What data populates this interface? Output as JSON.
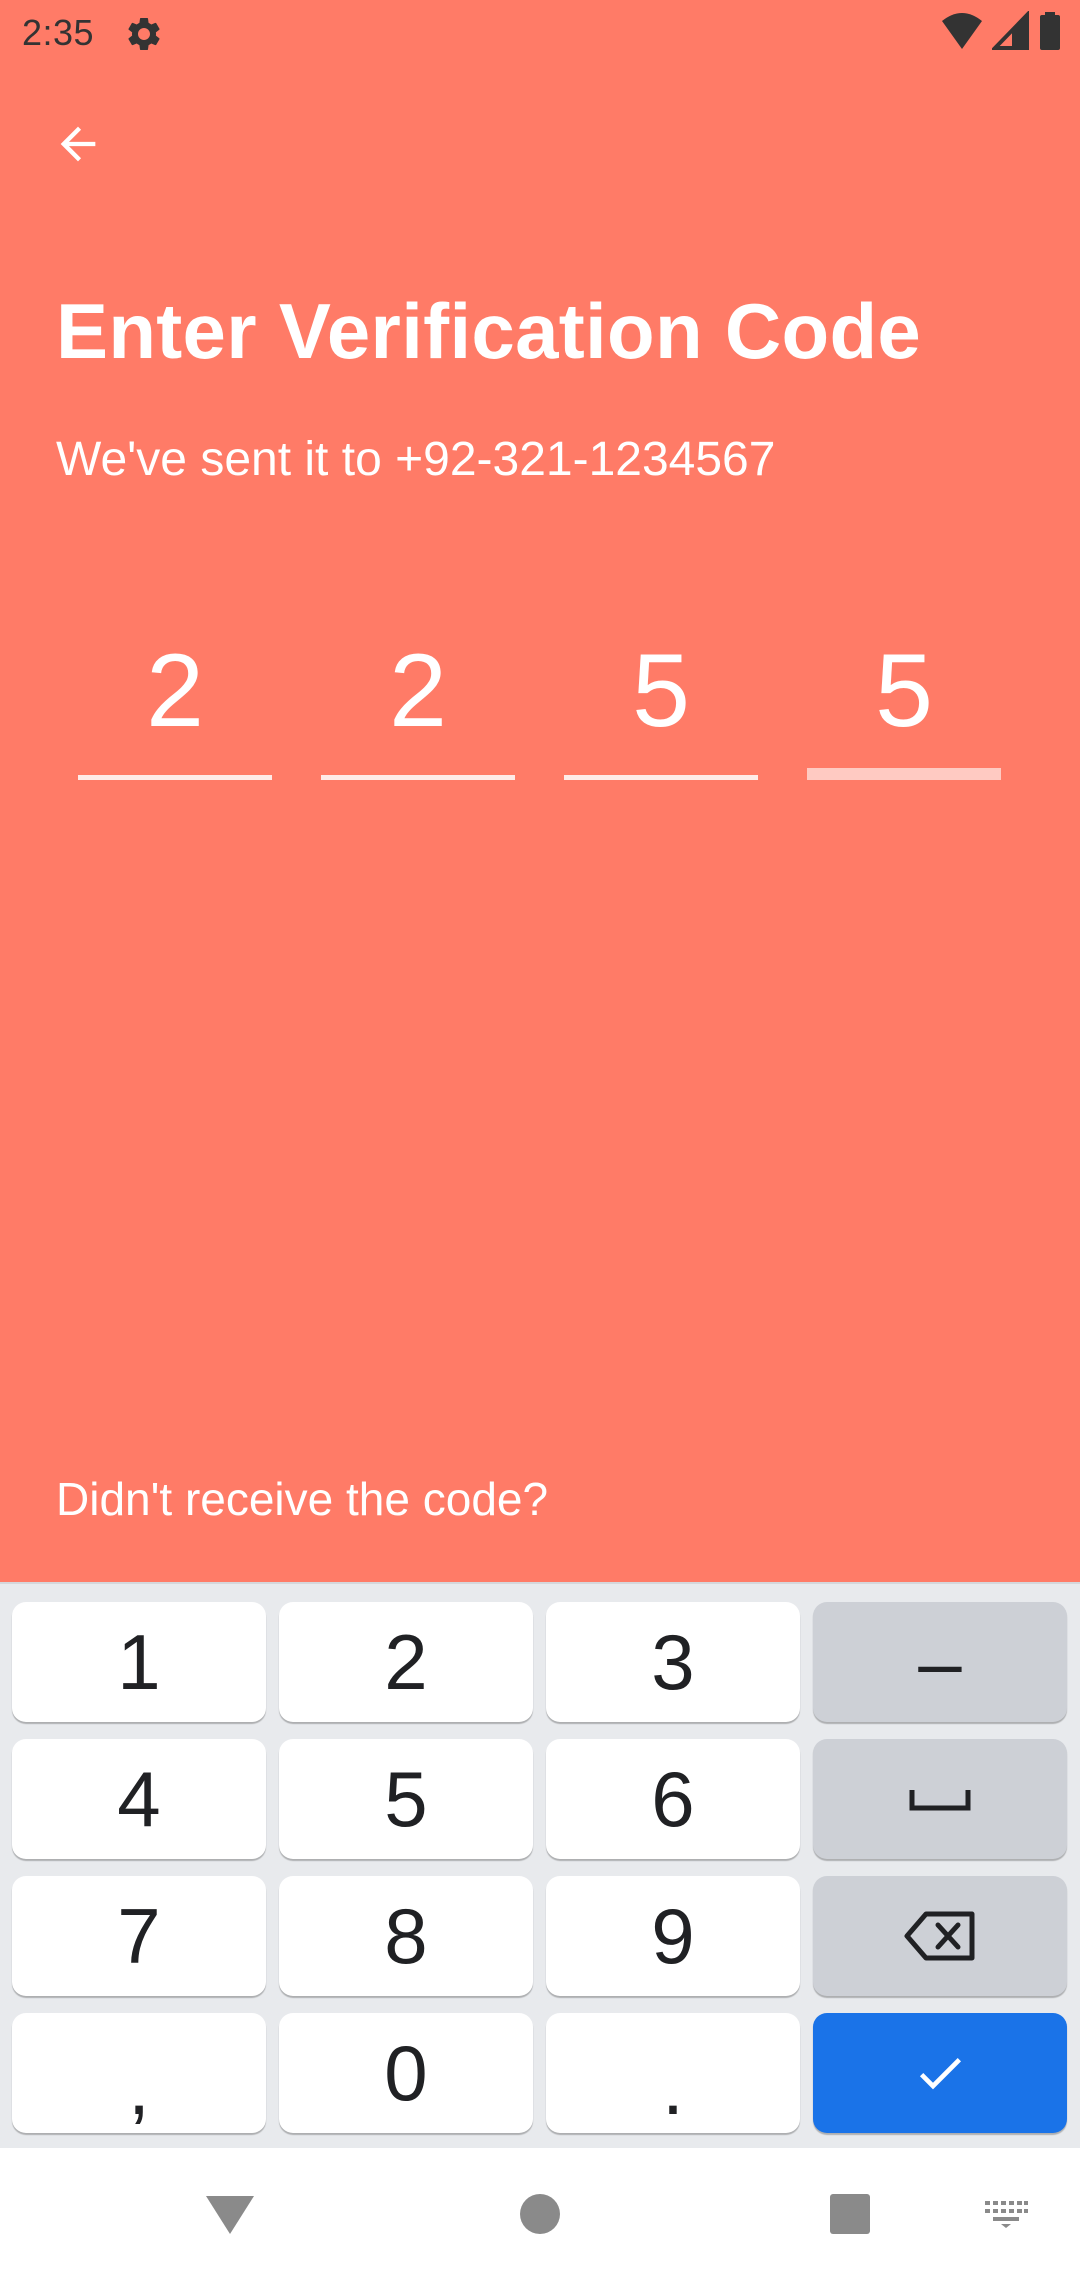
{
  "status_bar": {
    "time": "2:35",
    "icons": [
      "gear-icon",
      "wifi-icon",
      "signal-icon",
      "battery-icon"
    ]
  },
  "header": {
    "back_icon": "arrow-left-icon"
  },
  "title": "Enter Verification Code",
  "subtitle": "We've sent it to +92-321-1234567",
  "code": {
    "digits": [
      "2",
      "2",
      "5",
      "5"
    ],
    "active_index": 3
  },
  "resend_text": "Didn't receive the code?",
  "keyboard": {
    "rows": [
      [
        "1",
        "2",
        "3",
        "–"
      ],
      [
        "4",
        "5",
        "6",
        "space-icon"
      ],
      [
        "7",
        "8",
        "9",
        "backspace-icon"
      ],
      [
        ",",
        "0",
        ".",
        "check-icon"
      ]
    ],
    "key_1": "1",
    "key_2": "2",
    "key_3": "3",
    "key_dash": "–",
    "key_4": "4",
    "key_5": "5",
    "key_6": "6",
    "key_7": "7",
    "key_8": "8",
    "key_9": "9",
    "key_comma": ",",
    "key_0": "0",
    "key_period": "."
  },
  "colors": {
    "background": "#ff7b67",
    "keyboard_bg": "#e8eaed",
    "key_bg": "#ffffff",
    "key_gray": "#cdd0d6",
    "accent_blue": "#1a73e8"
  },
  "nav_bar": {
    "icons": [
      "back-triangle-icon",
      "home-circle-icon",
      "recents-square-icon",
      "keyboard-icon"
    ]
  }
}
